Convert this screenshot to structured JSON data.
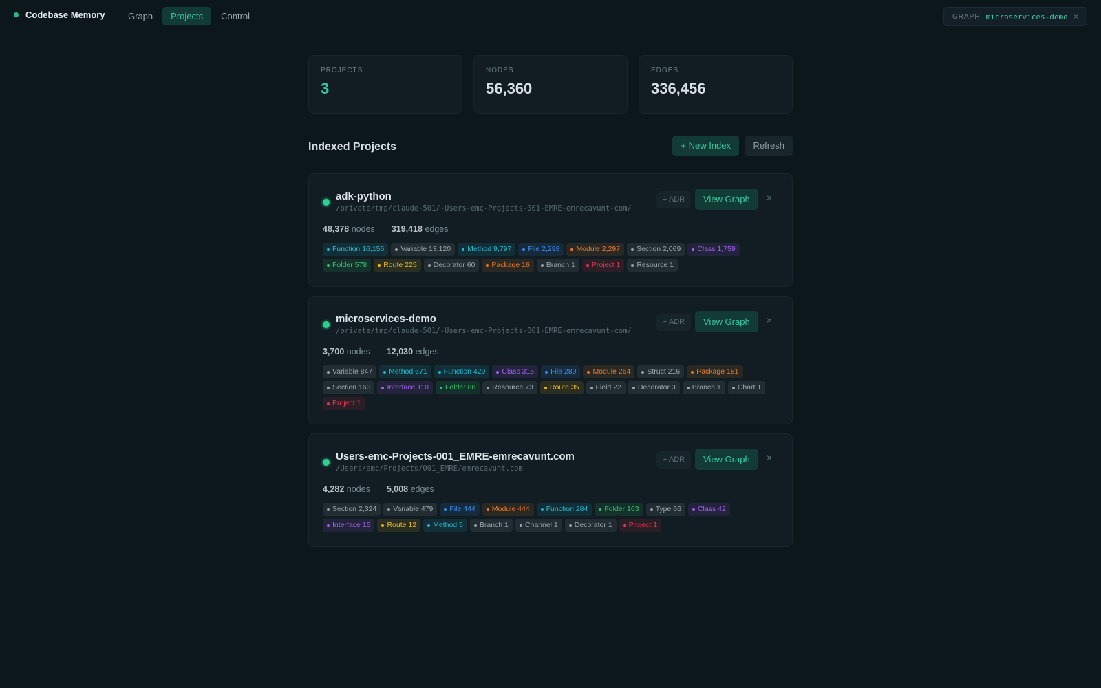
{
  "app": {
    "title": "Codebase Memory"
  },
  "nav": {
    "tabs": [
      {
        "label": "Graph",
        "active": false
      },
      {
        "label": "Projects",
        "active": true
      },
      {
        "label": "Control",
        "active": false
      }
    ]
  },
  "graph_chip": {
    "label": "GRAPH",
    "value": "microservices-demo",
    "close": "×"
  },
  "stats": [
    {
      "label": "PROJECTS",
      "value": "3",
      "accent": true
    },
    {
      "label": "NODES",
      "value": "56,360",
      "accent": false
    },
    {
      "label": "EDGES",
      "value": "336,456",
      "accent": false
    }
  ],
  "section": {
    "title": "Indexed Projects",
    "new_index_label": "+ New Index",
    "refresh_label": "Refresh"
  },
  "colors": {
    "teal": "#22b8cf",
    "gray": "#9aa6ab",
    "blue": "#3b8ef0",
    "orange": "#e8792a",
    "purple": "#a45ef0",
    "green": "#2fc46a",
    "yellow": "#e9b81c",
    "red": "#e8334e"
  },
  "projects": [
    {
      "name": "adk-python",
      "path": "/private/tmp/claude-501/-Users-emc-Projects-001-EMRE-emrecavunt-com/",
      "nodes": "48,378",
      "nodes_label": "nodes",
      "edges": "319,418",
      "edges_label": "edges",
      "adr_label": "+ ADR",
      "view_label": "View Graph",
      "remove_label": "×",
      "tags": [
        {
          "label": "Function 16,156",
          "color": "teal"
        },
        {
          "label": "Variable 13,120",
          "color": "gray"
        },
        {
          "label": "Method 9,797",
          "color": "teal"
        },
        {
          "label": "File 2,298",
          "color": "blue"
        },
        {
          "label": "Module 2,297",
          "color": "orange"
        },
        {
          "label": "Section 2,069",
          "color": "gray"
        },
        {
          "label": "Class 1,759",
          "color": "purple"
        },
        {
          "label": "Folder 578",
          "color": "green"
        },
        {
          "label": "Route 225",
          "color": "yellow"
        },
        {
          "label": "Decorator 60",
          "color": "gray"
        },
        {
          "label": "Package 16",
          "color": "orange"
        },
        {
          "label": "Branch 1",
          "color": "gray"
        },
        {
          "label": "Project 1",
          "color": "red"
        },
        {
          "label": "Resource 1",
          "color": "gray"
        }
      ]
    },
    {
      "name": "microservices-demo",
      "path": "/private/tmp/claude-501/-Users-emc-Projects-001-EMRE-emrecavunt-com/",
      "nodes": "3,700",
      "nodes_label": "nodes",
      "edges": "12,030",
      "edges_label": "edges",
      "adr_label": "+ ADR",
      "view_label": "View Graph",
      "remove_label": "×",
      "tags": [
        {
          "label": "Variable 847",
          "color": "gray"
        },
        {
          "label": "Method 671",
          "color": "teal"
        },
        {
          "label": "Function 429",
          "color": "teal"
        },
        {
          "label": "Class 315",
          "color": "purple"
        },
        {
          "label": "File 280",
          "color": "blue"
        },
        {
          "label": "Module 264",
          "color": "orange"
        },
        {
          "label": "Struct 216",
          "color": "gray"
        },
        {
          "label": "Package 181",
          "color": "orange"
        },
        {
          "label": "Section 163",
          "color": "gray"
        },
        {
          "label": "Interface 110",
          "color": "purple"
        },
        {
          "label": "Folder 88",
          "color": "green"
        },
        {
          "label": "Resource 73",
          "color": "gray"
        },
        {
          "label": "Route 35",
          "color": "yellow"
        },
        {
          "label": "Field 22",
          "color": "gray"
        },
        {
          "label": "Decorator 3",
          "color": "gray"
        },
        {
          "label": "Branch 1",
          "color": "gray"
        },
        {
          "label": "Chart 1",
          "color": "gray"
        },
        {
          "label": "Project 1",
          "color": "red"
        }
      ]
    },
    {
      "name": "Users-emc-Projects-001_EMRE-emrecavunt.com",
      "path": "/Users/emc/Projects/001_EMRE/emrecavunt.com",
      "nodes": "4,282",
      "nodes_label": "nodes",
      "edges": "5,008",
      "edges_label": "edges",
      "adr_label": "+ ADR",
      "view_label": "View Graph",
      "remove_label": "×",
      "tags": [
        {
          "label": "Section 2,324",
          "color": "gray"
        },
        {
          "label": "Variable 479",
          "color": "gray"
        },
        {
          "label": "File 444",
          "color": "blue"
        },
        {
          "label": "Module 444",
          "color": "orange"
        },
        {
          "label": "Function 284",
          "color": "teal"
        },
        {
          "label": "Folder 163",
          "color": "green"
        },
        {
          "label": "Type 66",
          "color": "gray"
        },
        {
          "label": "Class 42",
          "color": "purple"
        },
        {
          "label": "Interface 15",
          "color": "purple"
        },
        {
          "label": "Route 12",
          "color": "yellow"
        },
        {
          "label": "Method 5",
          "color": "teal"
        },
        {
          "label": "Branch 1",
          "color": "gray"
        },
        {
          "label": "Channel 1",
          "color": "gray"
        },
        {
          "label": "Decorator 1",
          "color": "gray"
        },
        {
          "label": "Project 1",
          "color": "red"
        }
      ]
    }
  ]
}
